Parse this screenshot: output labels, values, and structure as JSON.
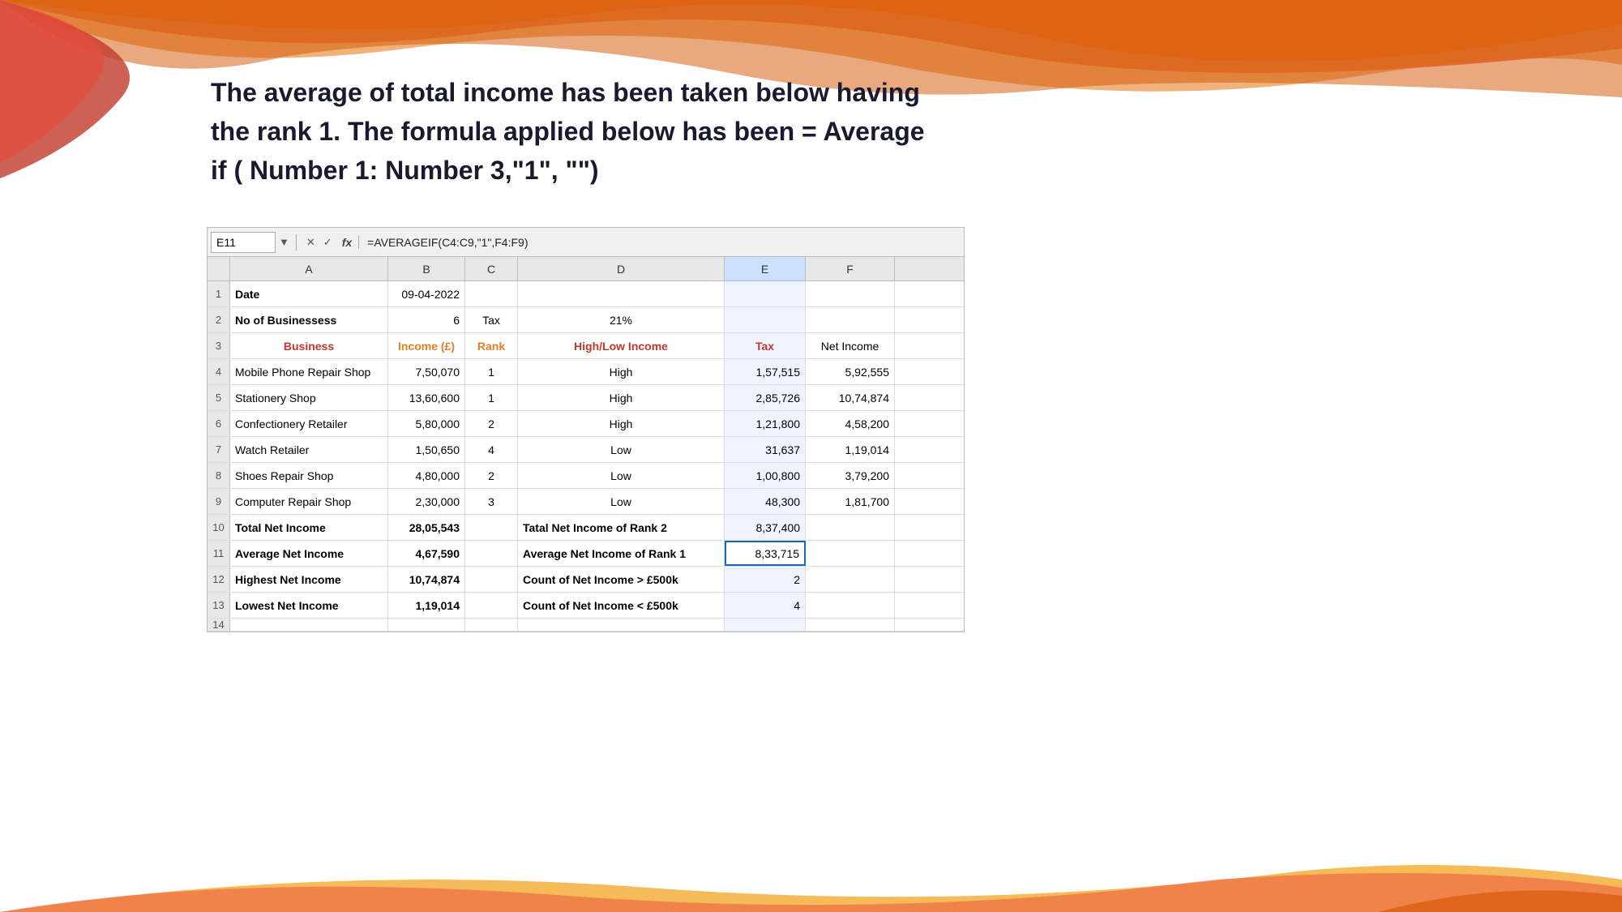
{
  "background": {
    "top_height": 220,
    "bottom_height": 120
  },
  "header": {
    "text_line1": "The average of total income has been taken below having",
    "text_line2": "the rank 1. The formula applied below has been = Average",
    "text_line3": "if ( Number 1: Number 3,\"1\", \"\")"
  },
  "formula_bar": {
    "cell_ref": "E11",
    "dropdown_arrow": "▼",
    "icon_x": "✕",
    "icon_check": "✓",
    "fx": "fx",
    "formula": "=AVERAGEIF(C4:C9,\"1\",F4:F9)"
  },
  "columns": {
    "row_header": "",
    "a": "A",
    "b": "B",
    "c": "C",
    "d": "D",
    "e": "E",
    "f": "F"
  },
  "rows": [
    {
      "num": "1",
      "a": "Date",
      "b": "09-04-2022",
      "c": "",
      "d": "",
      "e": "",
      "f": "",
      "a_style": "bold",
      "b_align": "right"
    },
    {
      "num": "2",
      "a": "No of Businessess",
      "b": "6",
      "c": "Tax",
      "d": "21%",
      "e": "",
      "f": "",
      "a_style": "bold",
      "b_align": "right",
      "c_align": "center",
      "d_align": "center"
    },
    {
      "num": "3",
      "a": "Business",
      "b": "Income (£)",
      "c": "Rank",
      "d": "High/Low Income",
      "e": "Tax",
      "f": "Net Income",
      "style": "orange_header"
    },
    {
      "num": "4",
      "a": "Mobile Phone Repair Shop",
      "b": "7,50,070",
      "c": "1",
      "d": "High",
      "e": "1,57,515",
      "f": "5,92,555"
    },
    {
      "num": "5",
      "a": "Stationery Shop",
      "b": "13,60,600",
      "c": "1",
      "d": "High",
      "e": "2,85,726",
      "f": "10,74,874"
    },
    {
      "num": "6",
      "a": "Confectionery Retailer",
      "b": "5,80,000",
      "c": "2",
      "d": "High",
      "e": "1,21,800",
      "f": "4,58,200"
    },
    {
      "num": "7",
      "a": "Watch Retailer",
      "b": "1,50,650",
      "c": "4",
      "d": "Low",
      "e": "31,637",
      "f": "1,19,014"
    },
    {
      "num": "8",
      "a": "Shoes Repair Shop",
      "b": "4,80,000",
      "c": "2",
      "d": "Low",
      "e": "1,00,800",
      "f": "3,79,200"
    },
    {
      "num": "9",
      "a": "Computer Repair Shop",
      "b": "2,30,000",
      "c": "3",
      "d": "Low",
      "e": "48,300",
      "f": "1,81,700"
    },
    {
      "num": "10",
      "a": "Total Net Income",
      "b": "28,05,543",
      "c": "",
      "d": "Tatal Net Income of Rank 2",
      "e": "8,37,400",
      "f": "",
      "a_style": "bold",
      "b_style": "bold",
      "d_style": "bold"
    },
    {
      "num": "11",
      "a": "Average Net Income",
      "b": "4,67,590",
      "c": "",
      "d": "Average Net Income of Rank 1",
      "e": "8,33,715",
      "f": "",
      "a_style": "bold",
      "b_style": "bold",
      "d_style": "bold",
      "e_selected": true
    },
    {
      "num": "12",
      "a": "Highest Net Income",
      "b": "10,74,874",
      "c": "",
      "d": "Count of Net Income > £500k",
      "e": "2",
      "f": "",
      "a_style": "bold",
      "b_style": "bold",
      "d_style": "bold"
    },
    {
      "num": "13",
      "a": "Lowest Net Income",
      "b": "1,19,014",
      "c": "",
      "d": "Count of Net Income < £500k",
      "e": "4",
      "f": "",
      "a_style": "bold",
      "b_style": "bold",
      "d_style": "bold"
    }
  ]
}
